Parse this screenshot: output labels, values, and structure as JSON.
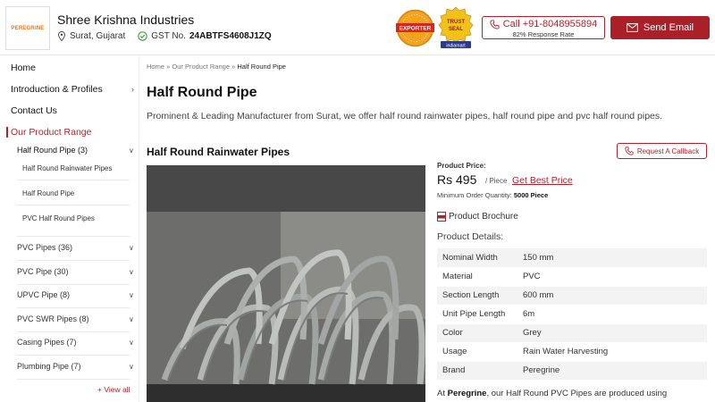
{
  "header": {
    "logo_text": "PEREGRINE",
    "company_name": "Shree Krishna Industries",
    "location": "Surat, Gujarat",
    "gst_label": "GST No.",
    "gst_number": "24ABTFS4608J1ZQ",
    "badge_exporter": "EXPORTER",
    "badge_trustseal": "TRUST SEAL",
    "badge_indiamart": "indiamart",
    "call_label": "Call +91-8048955894",
    "response_rate": "82% Response Rate",
    "email_label": "Send Email"
  },
  "sidebar": {
    "top_items": [
      {
        "label": "Home"
      },
      {
        "label": "Introduction & Profiles"
      },
      {
        "label": "Contact Us"
      }
    ],
    "range_label": "Our Product Range",
    "current_category": "Half Round Pipe (3)",
    "sub_items": [
      {
        "label": "Half Round Rainwater Pipes"
      },
      {
        "label": "Half Round Pipe"
      },
      {
        "label": "PVC Half Round Pipes"
      }
    ],
    "categories": [
      {
        "label": "PVC Pipes (36)"
      },
      {
        "label": "PVC Pipe (30)"
      },
      {
        "label": "UPVC Pipe (8)"
      },
      {
        "label": "PVC SWR Pipes (8)"
      },
      {
        "label": "Casing Pipes (7)"
      },
      {
        "label": "Plumbing Pipe (7)"
      }
    ],
    "view_all": "+ View all"
  },
  "main": {
    "breadcrumb": [
      "Home",
      "Our Product Range",
      "Half Round Pipe"
    ],
    "title": "Half Round Pipe",
    "description": "Prominent & Leading Manufacturer from Surat, we offer half round rainwater pipes, half round pipe and pvc half round pipes.",
    "product_title": "Half Round Rainwater Pipes",
    "callback_label": "Request A Callback",
    "price_label": "Product Price:",
    "price": "Rs 495",
    "price_unit": "/ Piece",
    "best_price": "Get Best Price",
    "moq_label": "Minimum Order Quantity:",
    "moq_value": "5000 Piece",
    "brochure": "Product Brochure",
    "details_label": "Product Details:",
    "specs": [
      {
        "key": "Nominal Width",
        "value": "150 mm"
      },
      {
        "key": "Material",
        "value": "PVC"
      },
      {
        "key": "Section Length",
        "value": "600 mm"
      },
      {
        "key": "Unit Pipe Length",
        "value": "6m"
      },
      {
        "key": "Color",
        "value": "Grey"
      },
      {
        "key": "Usage",
        "value": "Rain Water Harvesting"
      },
      {
        "key": "Brand",
        "value": "Peregrine"
      }
    ],
    "para_prefix": "At",
    "para_brand": "Peregrine",
    "para_rest": ", our Half Round PVC Pipes are produced using"
  },
  "colors": {
    "accent": "#b51f2a",
    "email_button": "#a92029"
  }
}
